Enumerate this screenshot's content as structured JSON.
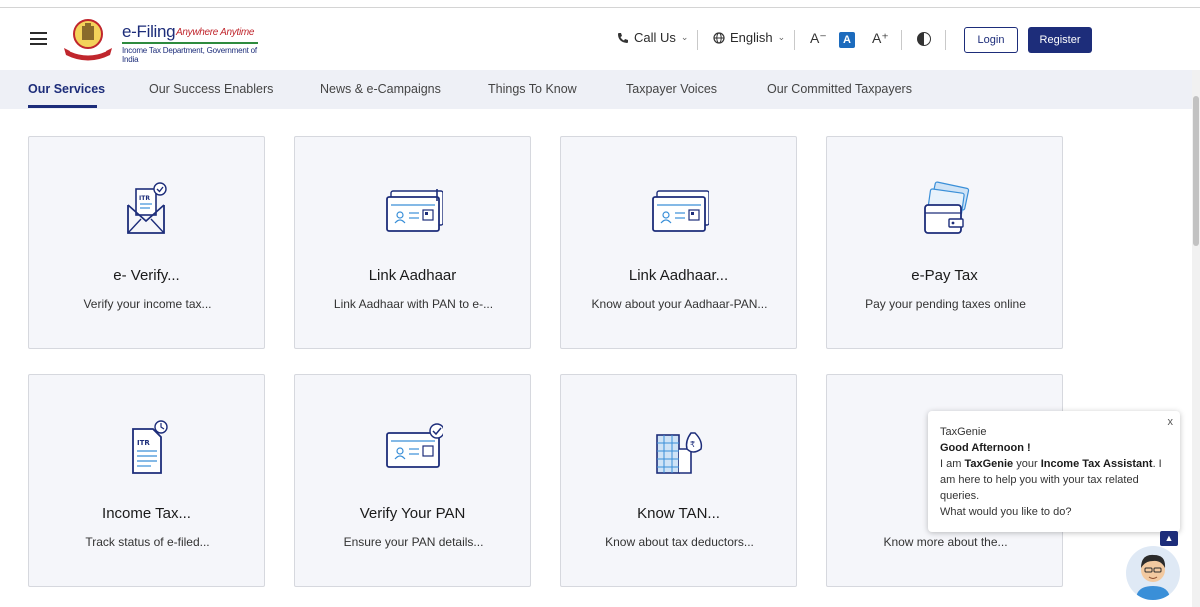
{
  "header": {
    "logo": {
      "title": "e-Filing",
      "tagline": "Anywhere Anytime",
      "subtitle": "Income Tax Department, Government of India"
    },
    "call_us": "Call Us",
    "language": "English",
    "font_decrease": "A⁻",
    "font_normal": "A",
    "font_increase": "A⁺",
    "login": "Login",
    "register": "Register"
  },
  "tabs": [
    {
      "label": "Our Services",
      "active": true
    },
    {
      "label": "Our Success Enablers"
    },
    {
      "label": "News & e-Campaigns"
    },
    {
      "label": "Things To Know"
    },
    {
      "label": "Taxpayer Voices"
    },
    {
      "label": "Our Committed Taxpayers"
    }
  ],
  "cards": [
    {
      "icon": "itr-envelope-icon",
      "title": "e- Verify...",
      "desc": "Verify your income tax..."
    },
    {
      "icon": "aadhaar-card-icon",
      "title": "Link Aadhaar",
      "desc": "Link Aadhaar with PAN to e-..."
    },
    {
      "icon": "aadhaar-card-status-icon",
      "title": "Link Aadhaar...",
      "desc": "Know about your Aadhaar-PAN..."
    },
    {
      "icon": "wallet-cards-icon",
      "title": "e-Pay Tax",
      "desc": "Pay your pending taxes online"
    },
    {
      "icon": "itr-status-icon",
      "title": "Income Tax...",
      "desc": "Track status of e-filed..."
    },
    {
      "icon": "pan-verify-icon",
      "title": "Verify Your PAN",
      "desc": "Ensure your PAN details..."
    },
    {
      "icon": "tan-building-icon",
      "title": "Know TAN...",
      "desc": "Know about tax deductors..."
    },
    {
      "icon": "info-icon",
      "title": "",
      "desc": "Know more about the..."
    }
  ],
  "chat": {
    "name": "TaxGenie",
    "greeting": "Good Afternoon !",
    "line1_pre": "I am ",
    "line1_bold1": "TaxGenie",
    "line1_mid": " your ",
    "line1_bold2": "Income Tax Assistant",
    "line1_post": ". I am here to help you with your tax related queries.",
    "question": "What would you like to do?",
    "close": "x"
  },
  "colors": {
    "brand": "#1d2d7a",
    "accent": "#1c6bbd",
    "card_bg": "#f5f6fa",
    "tab_bar": "#eef0f6"
  }
}
